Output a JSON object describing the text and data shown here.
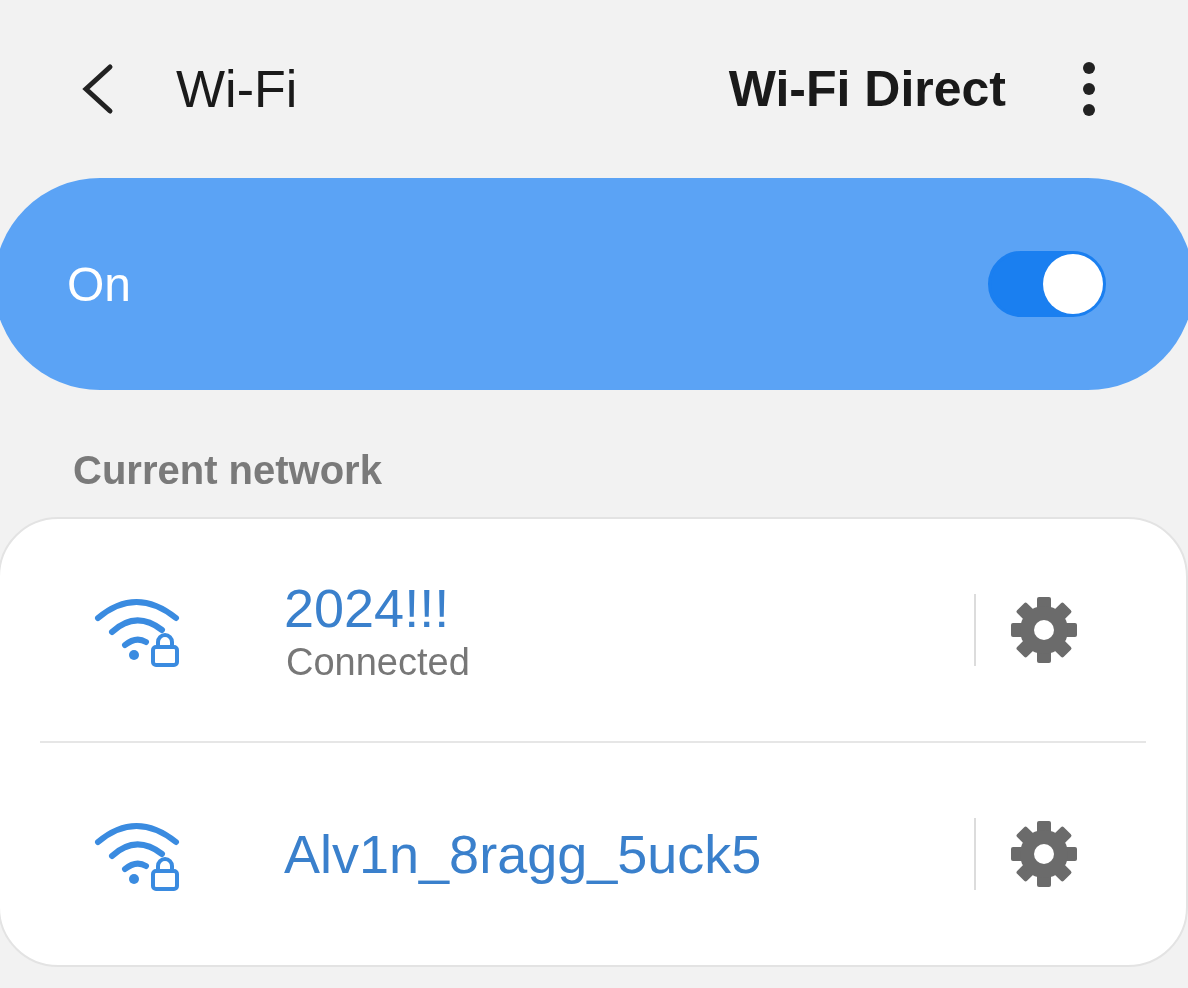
{
  "header": {
    "title": "Wi-Fi",
    "action": "Wi-Fi Direct"
  },
  "master_switch": {
    "label": "On",
    "on": true
  },
  "section_title": "Current network",
  "networks": [
    {
      "name": "2024!!!",
      "status": "Connected"
    },
    {
      "name": "Alv1n_8ragg_5uck5"
    }
  ]
}
